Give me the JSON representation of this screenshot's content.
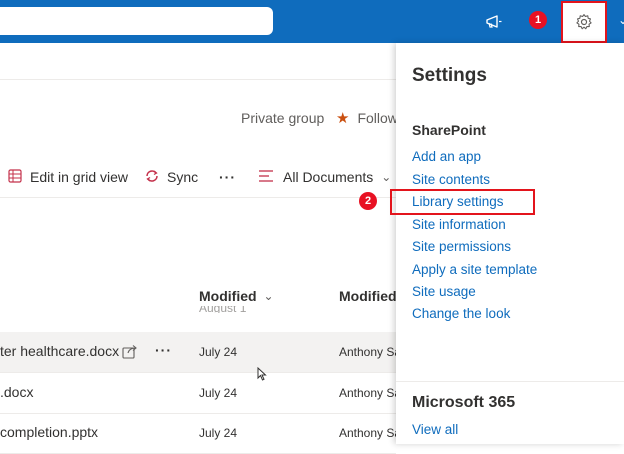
{
  "header": {
    "search_placeholder": "",
    "megaphone_icon": "megaphone-icon",
    "settings_icon": "gear-icon",
    "accent": "#0f6cbd"
  },
  "markers": {
    "one": "1",
    "two": "2",
    "color": "#e81123"
  },
  "site": {
    "group_label": "Private group",
    "follow_label": "Follow"
  },
  "commands": {
    "edit_grid": "Edit in grid view",
    "sync": "Sync",
    "more": "···",
    "view": "All Documents"
  },
  "columns": {
    "modified": "Modified",
    "modified_by": "Modified"
  },
  "files": [
    {
      "name": "ter healthcare.docx",
      "modified": "July 24",
      "modified_by": "Anthony Sa",
      "selected": true
    },
    {
      "name": ".docx",
      "modified": "July 24",
      "modified_by": "Anthony Sa"
    },
    {
      "name": "completion.pptx",
      "modified": "July 24",
      "modified_by": "Anthony Sa"
    }
  ],
  "partial_row_text": "August 1",
  "settings_panel": {
    "title": "Settings",
    "sharepoint_heading": "SharePoint",
    "links": [
      "Add an app",
      "Site contents",
      "Library settings",
      "Site information",
      "Site permissions",
      "Apply a site template",
      "Site usage",
      "Change the look"
    ],
    "m365_heading": "Microsoft 365",
    "view_all": "View all"
  }
}
